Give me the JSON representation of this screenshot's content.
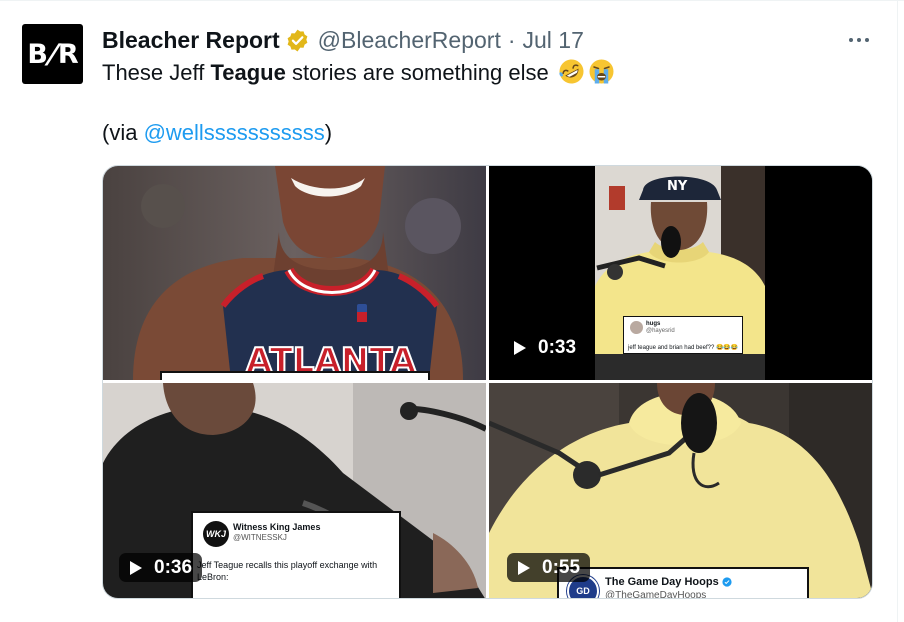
{
  "tweet": {
    "author": {
      "display_name": "Bleacher Report",
      "handle": "@BleacherReport",
      "separator": "·",
      "date": "Jul 17",
      "avatar_text_left": "B",
      "avatar_text_slash": "/",
      "avatar_text_right": "R"
    },
    "text": {
      "part1": "These Jeff ",
      "bold": "Teague",
      "part2": " stories are something else ",
      "emojis": [
        "rolling-on-floor-laughing-emoji",
        "loudly-crying-emoji"
      ],
      "via_prefix": "(via ",
      "mention": "@wellsssssssssss",
      "via_suffix": ")"
    },
    "more_menu": "more-options-icon"
  },
  "media": {
    "tiles": [
      {
        "kind": "image",
        "jersey_text": "ATLANTA"
      },
      {
        "kind": "video",
        "duration": "0:33",
        "cap_text": "NY",
        "overlay_card": {
          "username": "hugs",
          "handle": "@hayesrid",
          "text": "jeff teague and brian had beef?? 😂😂😂"
        }
      },
      {
        "kind": "video",
        "duration": "0:36",
        "overlay_card": {
          "logo": "WKJ",
          "name": "Witness King James",
          "handle": "@WITNESSKJ",
          "text": "Jeff Teague recalls this playoff exchange with LeBron:"
        }
      },
      {
        "kind": "video",
        "duration": "0:55",
        "overlay_card": {
          "logo": "GD",
          "name": "The Game Day Hoops",
          "handle": "@TheGameDayHoops"
        }
      }
    ]
  },
  "colors": {
    "link": "#1d9bf0",
    "secondary_text": "#536471",
    "verified_gold": "#e2b719"
  }
}
